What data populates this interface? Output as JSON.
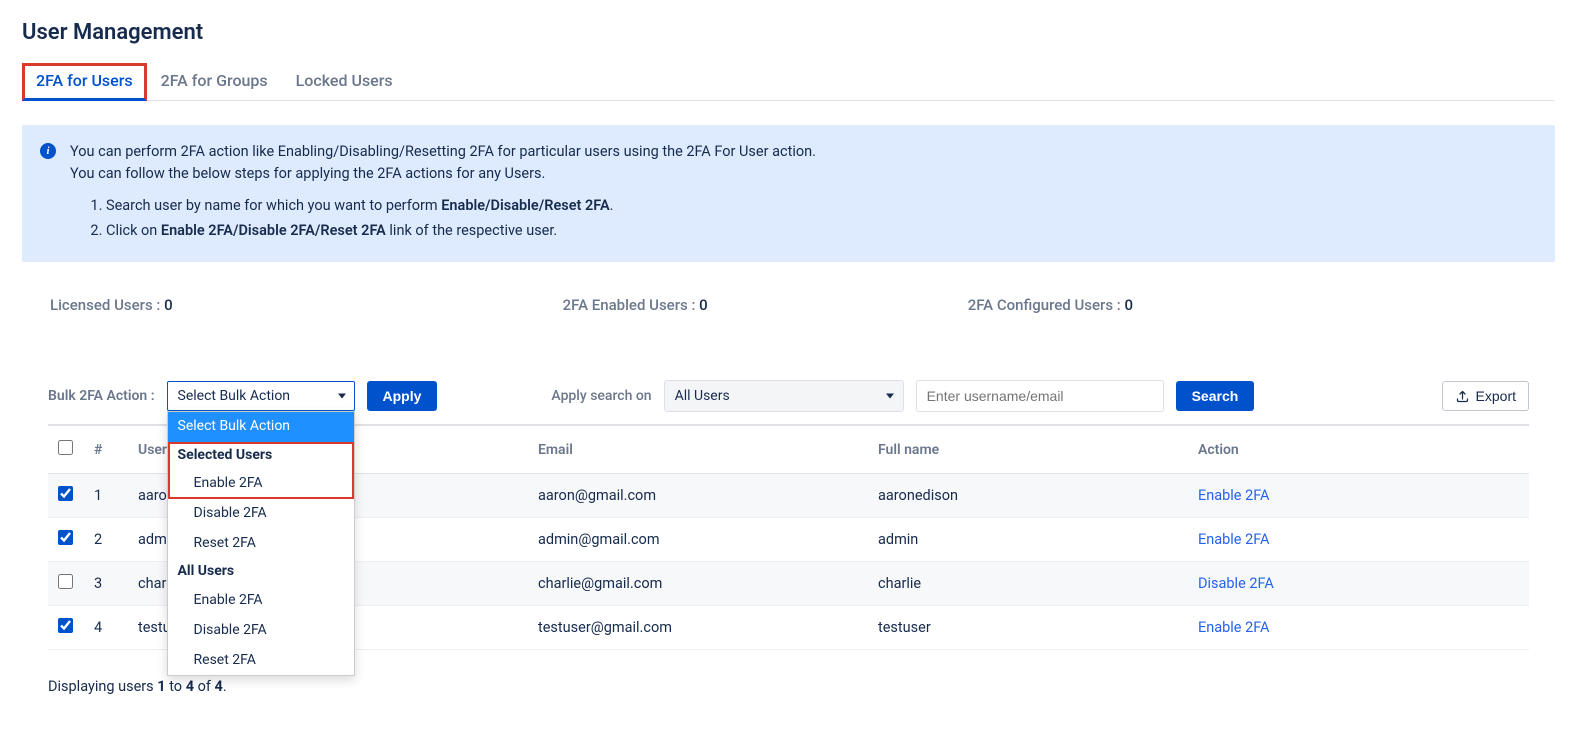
{
  "pageTitle": "User Management",
  "tabs": [
    {
      "label": "2FA for Users",
      "active": true
    },
    {
      "label": "2FA for Groups",
      "active": false
    },
    {
      "label": "Locked Users",
      "active": false
    }
  ],
  "info": {
    "line1": "You can perform 2FA action like Enabling/Disabling/Resetting 2FA for particular users using the 2FA For User action.",
    "line2": "You can follow the below steps for applying the 2FA actions for any Users.",
    "step1_pre": "Search user by name for which you want to perform ",
    "step1_bold": "Enable/Disable/Reset 2FA",
    "step1_post": ".",
    "step2_pre": "Click on ",
    "step2_bold": "Enable 2FA/Disable 2FA/Reset 2FA",
    "step2_post": " link of the respective user."
  },
  "stats": {
    "licensedLabel": "Licensed Users : ",
    "licensedVal": "0",
    "enabledLabel": "2FA Enabled Users : ",
    "enabledVal": "0",
    "configuredLabel": "2FA Configured Users : ",
    "configuredVal": "0"
  },
  "controls": {
    "bulkLabel": "Bulk 2FA Action :",
    "bulkSelected": "Select Bulk Action",
    "applyLabel": "Apply",
    "applySearchLabel": "Apply search on",
    "applySearchValue": "All Users",
    "searchPlaceholder": "Enter username/email",
    "searchButton": "Search",
    "exportLabel": "Export"
  },
  "dropdown": {
    "opt0": "Select Bulk Action",
    "group1": "Selected Users",
    "g1o1": "Enable 2FA",
    "g1o2": "Disable 2FA",
    "g1o3": "Reset 2FA",
    "group2": "All Users",
    "g2o1": "Enable 2FA",
    "g2o2": "Disable 2FA",
    "g2o3": "Reset 2FA"
  },
  "table": {
    "headers": {
      "num": "#",
      "user": "Username",
      "email": "Email",
      "full": "Full name",
      "action": "Action"
    },
    "rows": [
      {
        "checked": true,
        "num": "1",
        "user": "aaron",
        "email": "aaron@gmail.com",
        "full": "aaronedison",
        "action": "Enable 2FA"
      },
      {
        "checked": true,
        "num": "2",
        "user": "admin",
        "email": "admin@gmail.com",
        "full": "admin",
        "action": "Enable 2FA"
      },
      {
        "checked": false,
        "num": "3",
        "user": "charlie",
        "email": "charlie@gmail.com",
        "full": "charlie",
        "action": "Disable 2FA"
      },
      {
        "checked": true,
        "num": "4",
        "user": "testuser",
        "email": "testuser@gmail.com",
        "full": "testuser",
        "action": "Enable 2FA"
      }
    ]
  },
  "footer": {
    "pre": "Displaying users ",
    "from": "1",
    "mid1": " to ",
    "to": "4",
    "mid2": " of ",
    "total": "4",
    "post": "."
  }
}
